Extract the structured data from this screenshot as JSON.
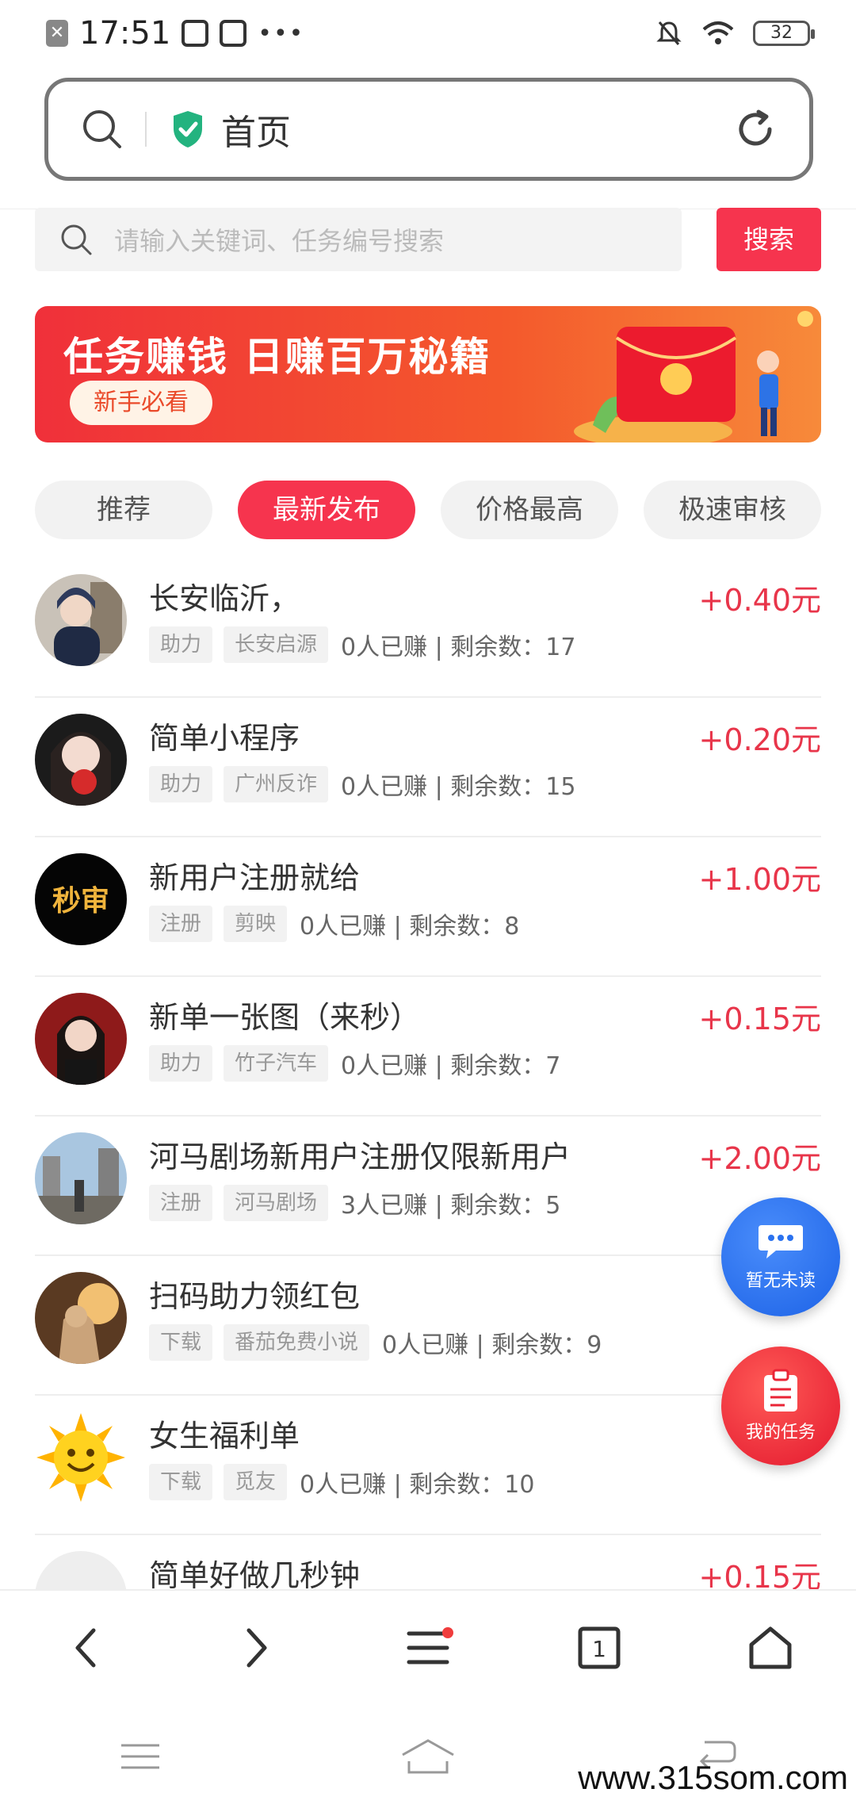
{
  "status_bar": {
    "time": "17:51",
    "dots": "•••",
    "battery": "32"
  },
  "browser": {
    "title": "首页"
  },
  "search": {
    "placeholder": "请输入关键词、任务编号搜索",
    "button_label": "搜索"
  },
  "banner": {
    "title": "任务赚钱 日赚百万秘籍",
    "badge": "新手必看",
    "icon": "red-envelope-icon"
  },
  "tabs": [
    {
      "label": "推荐",
      "active": false
    },
    {
      "label": "最新发布",
      "active": true
    },
    {
      "label": "价格最高",
      "active": false
    },
    {
      "label": "极速审核",
      "active": false
    }
  ],
  "tasks": [
    {
      "title": "长安临沂，",
      "price": "+0.40元",
      "tag1": "助力",
      "tag2": "长安启源",
      "meta": "0人已赚 | 剩余数：17"
    },
    {
      "title": "简单小程序",
      "price": "+0.20元",
      "tag1": "助力",
      "tag2": "广州反诈",
      "meta": "0人已赚 | 剩余数：15"
    },
    {
      "title": "新用户注册就给",
      "price": "+1.00元",
      "tag1": "注册",
      "tag2": "剪映",
      "meta": "0人已赚 | 剩余数：8"
    },
    {
      "title": "新单一张图（来秒）",
      "price": "+0.15元",
      "tag1": "助力",
      "tag2": "竹子汽车",
      "meta": "0人已赚 | 剩余数：7"
    },
    {
      "title": "河马剧场新用户注册仅限新用户",
      "price": "+2.00元",
      "tag1": "注册",
      "tag2": "河马剧场",
      "meta": "3人已赚 | 剩余数：5"
    },
    {
      "title": "扫码助力领红包",
      "price": "+2",
      "tag1": "下载",
      "tag2": "番茄免费小说",
      "meta": "0人已赚 | 剩余数：9"
    },
    {
      "title": "女生福利单",
      "price": "+",
      "tag1": "下载",
      "tag2": "觅友",
      "meta": "0人已赚 | 剩余数：10"
    },
    {
      "title": "简单好做几秒钟",
      "price": "+0.15元",
      "tag1": "",
      "tag2": "",
      "meta": ""
    }
  ],
  "avatar_text": "秒审",
  "fab": {
    "messages_label": "暂无未读",
    "my_tasks_label": "我的任务"
  },
  "bottom_nav": {
    "tab_count": "1"
  },
  "watermark": "www.315som.com",
  "colors": {
    "accent": "#f6344e",
    "price": "#e8354a",
    "fab_blue": "#2b72ef",
    "fab_red": "#ea2436"
  }
}
